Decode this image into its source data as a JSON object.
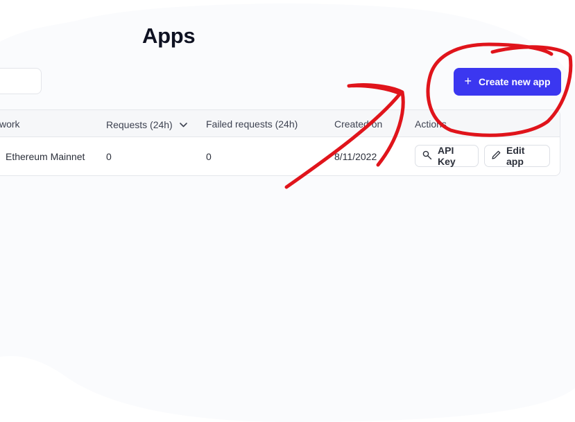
{
  "page": {
    "title": "Apps"
  },
  "toolbar": {
    "search_value": "",
    "create_label": "Create new app",
    "create_icon": "plus-icon"
  },
  "table": {
    "columns": [
      "work",
      "Requests (24h)",
      "Failed requests (24h)",
      "Created on",
      "Actions"
    ],
    "sort_icon": "chevron-down-icon",
    "rows": [
      {
        "network": "Ethereum Mainnet",
        "requests": "0",
        "failed_requests": "0",
        "created_on": "8/11/2022",
        "api_key_label": "API Key",
        "edit_label": "Edit app"
      }
    ]
  },
  "colors": {
    "accent": "#3b37f0",
    "annotation": "#e0141b",
    "background_blob": "#fafbfd"
  }
}
